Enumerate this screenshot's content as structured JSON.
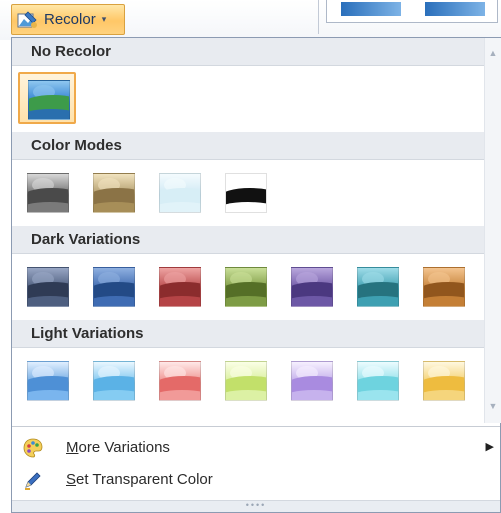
{
  "recolor_button": {
    "label": "Recolor",
    "icon": "recolor-icon",
    "caret": "▾"
  },
  "sections": [
    {
      "title": "No Recolor",
      "swatches": [
        {
          "name": "no-recolor",
          "selected": true,
          "colors": [
            "#2f7fd0",
            "#8fc7f0",
            "#3d9b4a",
            "#2a6fae"
          ]
        }
      ]
    },
    {
      "title": "Color Modes",
      "swatches": [
        {
          "name": "grayscale",
          "colors": [
            "#6e6e6e",
            "#d8d8d8",
            "#4a4a4a",
            "#7a7a7a"
          ]
        },
        {
          "name": "sepia",
          "colors": [
            "#b09a6a",
            "#f1e3bf",
            "#8b7346",
            "#a78e58"
          ]
        },
        {
          "name": "washout",
          "colors": [
            "#cfe9f4",
            "#f4fbfe",
            "#d7eef6",
            "#e1f3f9"
          ]
        },
        {
          "name": "black-and-white",
          "colors": [
            "#ffffff",
            "#ffffff",
            "#111111",
            "#ffffff"
          ]
        }
      ]
    },
    {
      "title": "Dark Variations",
      "swatches": [
        {
          "name": "dark-slate",
          "colors": [
            "#4a5a7a",
            "#98a6c4",
            "#2f3b55",
            "#4e5f80"
          ]
        },
        {
          "name": "dark-blue",
          "colors": [
            "#3c67ad",
            "#8fb0e0",
            "#234a86",
            "#3f6cb3"
          ]
        },
        {
          "name": "dark-red",
          "colors": [
            "#b8494a",
            "#eea4a3",
            "#8b2c2d",
            "#b54446"
          ]
        },
        {
          "name": "dark-green",
          "colors": [
            "#7d9a43",
            "#c9df98",
            "#556f27",
            "#7e9c45"
          ]
        },
        {
          "name": "dark-purple",
          "colors": [
            "#6e57a5",
            "#b9a7dd",
            "#4b3880",
            "#6d58a6"
          ]
        },
        {
          "name": "dark-teal",
          "colors": [
            "#3f9fb1",
            "#9fdce8",
            "#26737f",
            "#3ea0b2"
          ]
        },
        {
          "name": "dark-orange",
          "colors": [
            "#c6823a",
            "#f3c48f",
            "#91561d",
            "#c47f36"
          ]
        }
      ]
    },
    {
      "title": "Light Variations",
      "swatches": [
        {
          "name": "light-blue",
          "colors": [
            "#6fa9e2",
            "#e1efff",
            "#4e90d6",
            "#7ab5ee"
          ]
        },
        {
          "name": "light-sky",
          "colors": [
            "#7cc5ef",
            "#eaf7ff",
            "#5bb2e6",
            "#85ccf2"
          ]
        },
        {
          "name": "light-red",
          "colors": [
            "#ee8f8c",
            "#ffe9e8",
            "#e46a68",
            "#f19a98"
          ]
        },
        {
          "name": "light-lime",
          "colors": [
            "#d7ee9a",
            "#fbffe6",
            "#c2e06a",
            "#dcf1a4"
          ]
        },
        {
          "name": "light-lavender",
          "colors": [
            "#c0aaea",
            "#f6f0ff",
            "#a98be0",
            "#c6b2ed"
          ]
        },
        {
          "name": "light-aqua",
          "colors": [
            "#91e0ea",
            "#ecfcff",
            "#6ed3df",
            "#9ae4ee"
          ]
        },
        {
          "name": "light-gold",
          "colors": [
            "#f3cf6e",
            "#fff8e0",
            "#eebc3f",
            "#f5d57c"
          ]
        }
      ]
    }
  ],
  "menu": [
    {
      "name": "more-variations",
      "label_rest": "ore Variations",
      "accel": "M",
      "icon": "palette-icon",
      "has_submenu": true
    },
    {
      "name": "set-transparent-color",
      "label_rest": "et Transparent Color",
      "accel": "S",
      "icon": "pen-icon",
      "has_submenu": false
    }
  ],
  "grip": "••••"
}
